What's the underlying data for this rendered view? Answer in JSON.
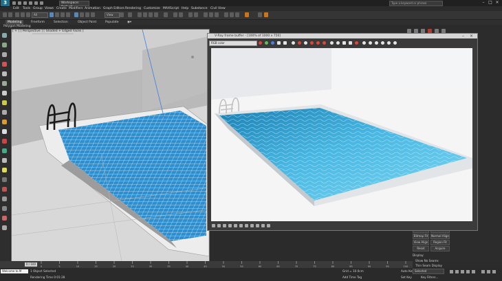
{
  "app": {
    "workspace_label": "Workspace: Default",
    "search_placeholder": "Type a keyword or phrase",
    "menus": [
      "Edit",
      "Tools",
      "Group",
      "Views",
      "Create",
      "Modifiers",
      "Animation",
      "Graph Editors",
      "Rendering",
      "Customize",
      "MAXScript",
      "Help",
      "Substance",
      "Civil View"
    ],
    "selection_filter": "All",
    "view_dropdown": "View"
  },
  "ribbon": {
    "tabs": [
      "Modeling",
      "Freeform",
      "Selection",
      "Object Paint",
      "Populate"
    ],
    "active_tab": "Modeling",
    "subtitle": "Polygon Modeling"
  },
  "viewport": {
    "label": "[ + ] [ Perspective ] [ Shaded + Edged Faces ]"
  },
  "vfb": {
    "title": "V-Ray frame buffer - [100% of 1000 x 750]",
    "channel": "RGB color"
  },
  "command_panel": {
    "buttons": [
      [
        "Fit",
        "Center"
      ],
      [
        "Bitmap Fit",
        "Normal Align"
      ],
      [
        "View Align",
        "Region Fit"
      ],
      [
        "Reset",
        "Acquire"
      ]
    ],
    "display_label": "Display:",
    "options": [
      "Show No Seams",
      "Thin Seam Display"
    ]
  },
  "timeline": {
    "position": "0 / 100",
    "ticks": [
      "0",
      "5",
      "10",
      "15",
      "20",
      "25",
      "30",
      "35",
      "40",
      "45",
      "50",
      "55",
      "60",
      "65",
      "70",
      "75",
      "80",
      "85",
      "90",
      "95",
      "100"
    ]
  },
  "status": {
    "welcome": "Welcome to M",
    "selected": "1 Object Selected",
    "render_time": "Rendering Time  0:01:28",
    "grid": "Grid = 10.0cm",
    "add_time_tag": "Add Time Tag",
    "auto_key": "Auto Key",
    "set_key": "Set Key",
    "selected_dd": "Selected",
    "key_filters": "Key Filters..."
  },
  "colors": {
    "ui_dark": "#2b2b2b",
    "pool_water": "#3aa6d8",
    "accent_blue": "#1d6f8a"
  }
}
